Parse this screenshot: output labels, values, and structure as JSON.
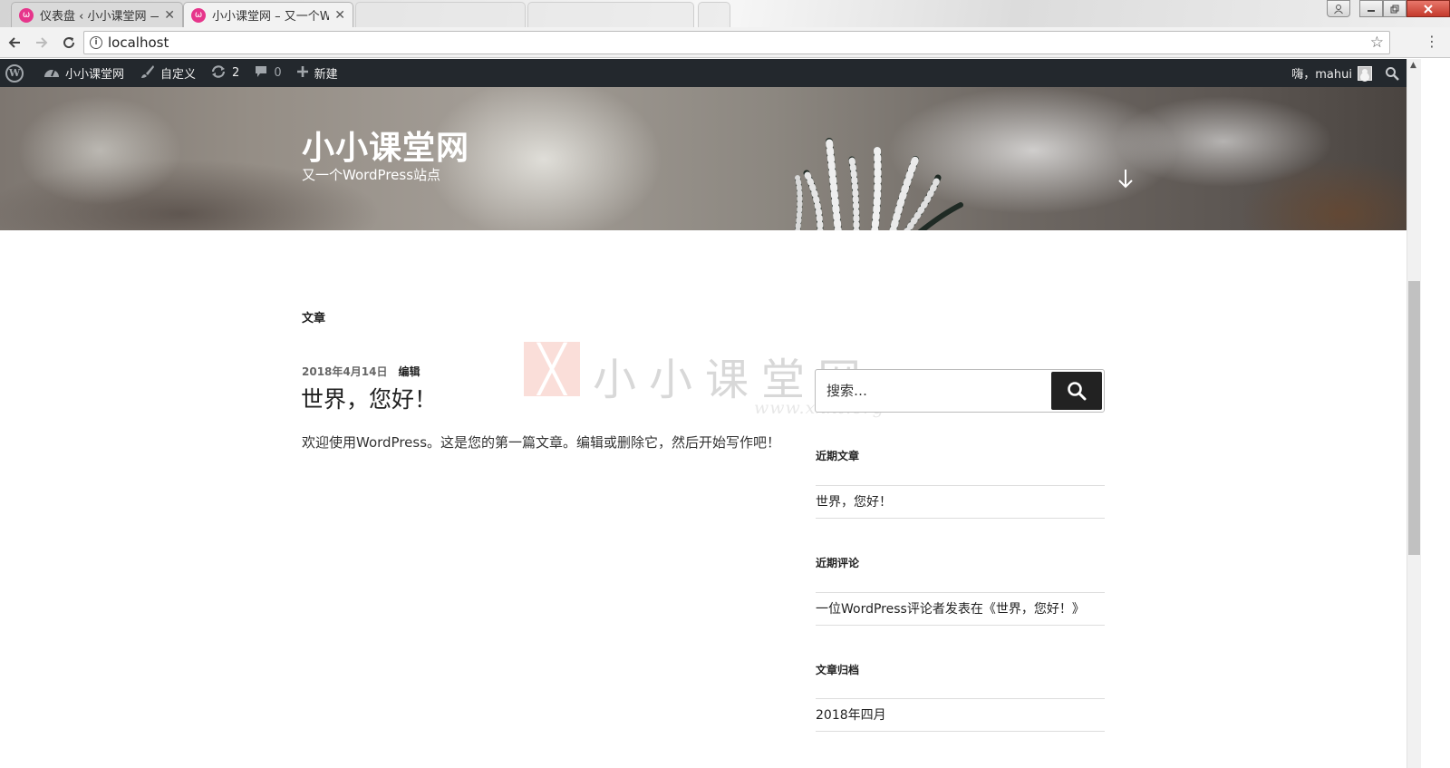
{
  "browser": {
    "tabs": [
      {
        "title": "仪表盘 ‹ 小小课堂网 — W",
        "active": false
      },
      {
        "title": "小小课堂网 – 又一个Wo",
        "active": true
      },
      {
        "title": "",
        "active": false
      },
      {
        "title": "",
        "active": false
      }
    ],
    "favicon_glyph": "ω",
    "close_glyph": "✕",
    "address": "localhost"
  },
  "adminbar": {
    "site_name": "小小课堂网",
    "customize": "自定义",
    "updates_count": "2",
    "comments_count": "0",
    "new": "新建",
    "greeting": "嗨，mahui"
  },
  "header": {
    "site_title": "小小课堂网",
    "site_description": "又一个WordPress站点"
  },
  "main": {
    "page_heading": "文章",
    "post": {
      "date": "2018年4月14日",
      "edit": "编辑",
      "title": "世界，您好！",
      "body": "欢迎使用WordPress。这是您的第一篇文章。编辑或删除它，然后开始写作吧！"
    }
  },
  "watermark": {
    "text": "小小课堂网",
    "url": "www.xxkt.org"
  },
  "sidebar": {
    "search_placeholder": "搜索…",
    "recent_posts_title": "近期文章",
    "recent_posts": [
      "世界，您好！"
    ],
    "recent_comments_title": "近期评论",
    "recent_comments": [
      "一位WordPress评论者发表在《世界，您好！》"
    ],
    "archives_title": "文章归档",
    "archives": [
      "2018年四月"
    ]
  },
  "colors": {
    "adminbar_bg": "#23282d",
    "favicon": "#e6358b",
    "search_button": "#222222"
  }
}
